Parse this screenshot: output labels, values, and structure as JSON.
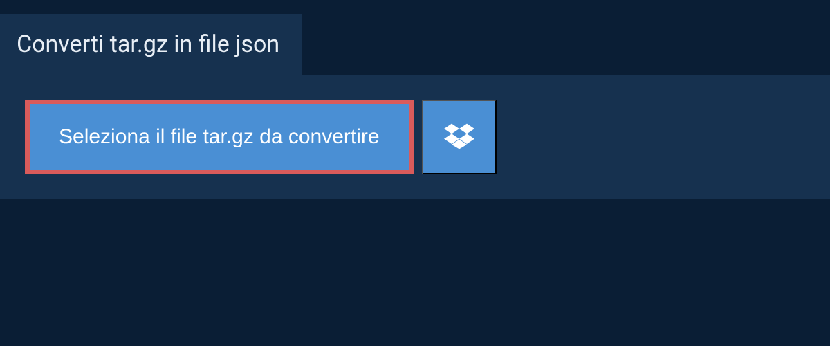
{
  "header": {
    "title": "Converti tar.gz in file json"
  },
  "upload": {
    "select_label": "Seleziona il file tar.gz da convertire"
  }
}
